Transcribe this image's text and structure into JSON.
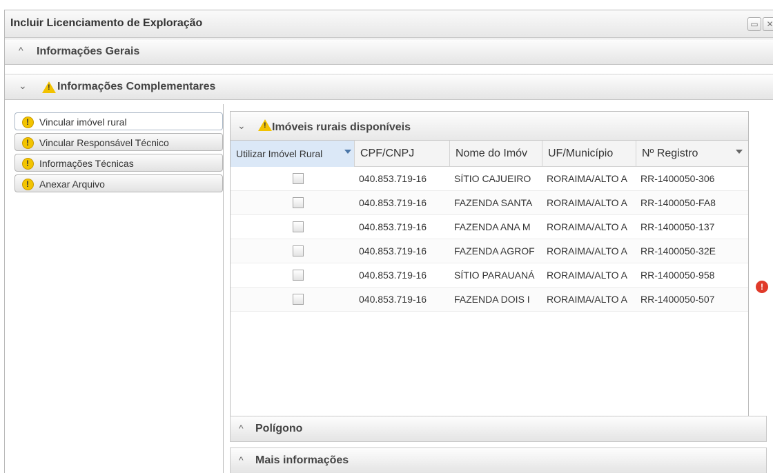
{
  "window": {
    "title": "Incluir Licenciamento de Exploração",
    "maximize_icon": "maximize-icon",
    "close_icon": "close-icon"
  },
  "sections": {
    "geral": {
      "label": "Informações Gerais",
      "expanded": false
    },
    "complementares": {
      "label": "Informações Complementares",
      "expanded": true
    }
  },
  "left_nav": [
    {
      "label": "Vincular imóvel rural",
      "active": true
    },
    {
      "label": "Vincular Responsável Técnico",
      "active": false
    },
    {
      "label": "Informações Técnicas",
      "active": false
    },
    {
      "label": "Anexar Arquivo",
      "active": false
    }
  ],
  "imoveis": {
    "title": "Imóveis rurais disponíveis",
    "columns": [
      "Utilizar Imóvel Rural",
      "CPF/CNPJ",
      "Nome do Imóvel",
      "UF/Município",
      "Nº Registro"
    ],
    "column_display": [
      "Utilizar Imóvel Rural",
      "CPF/CNPJ",
      "Nome do Imóv",
      "UF/Município",
      "Nº Registro"
    ],
    "rows": [
      {
        "checked": false,
        "cpf": "040.853.719-16",
        "nome": "SÍTIO CAJUEIRO",
        "uf": "RORAIMA/ALTO A",
        "registro": "RR-1400050-306"
      },
      {
        "checked": false,
        "cpf": "040.853.719-16",
        "nome": "FAZENDA SANTA",
        "uf": "RORAIMA/ALTO A",
        "registro": "RR-1400050-FA8"
      },
      {
        "checked": false,
        "cpf": "040.853.719-16",
        "nome": "FAZENDA ANA M",
        "uf": "RORAIMA/ALTO A",
        "registro": "RR-1400050-137"
      },
      {
        "checked": false,
        "cpf": "040.853.719-16",
        "nome": "FAZENDA AGROF",
        "uf": "RORAIMA/ALTO A",
        "registro": "RR-1400050-32E"
      },
      {
        "checked": false,
        "cpf": "040.853.719-16",
        "nome": "SÍTIO PARAUANÁ",
        "uf": "RORAIMA/ALTO A",
        "registro": "RR-1400050-958"
      },
      {
        "checked": false,
        "cpf": "040.853.719-16",
        "nome": "FAZENDA DOIS I",
        "uf": "RORAIMA/ALTO A",
        "registro": "RR-1400050-507"
      }
    ]
  },
  "subsections": {
    "poligono": {
      "label": "Polígono",
      "expanded": false
    },
    "mais": {
      "label": "Mais informações",
      "expanded": false
    }
  },
  "colors": {
    "warning": "#f2c200",
    "error": "#e03a2a",
    "selected_header": "#dbe8f7"
  }
}
